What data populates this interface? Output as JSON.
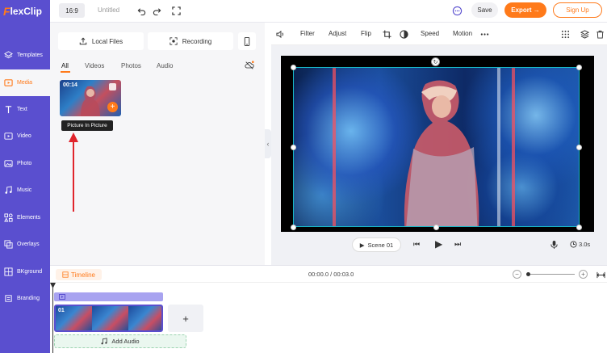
{
  "app": {
    "logo_mark": "F",
    "logo_text": "lexClip"
  },
  "sidebar": {
    "items": [
      {
        "label": "Templates",
        "icon": "templates-icon"
      },
      {
        "label": "Media",
        "icon": "media-icon",
        "active": true
      },
      {
        "label": "Text",
        "icon": "text-icon"
      },
      {
        "label": "Video",
        "icon": "video-icon"
      },
      {
        "label": "Photo",
        "icon": "photo-icon"
      },
      {
        "label": "Music",
        "icon": "music-icon"
      },
      {
        "label": "Elements",
        "icon": "elements-icon"
      },
      {
        "label": "Overlays",
        "icon": "overlays-icon"
      },
      {
        "label": "BKground",
        "icon": "background-icon"
      },
      {
        "label": "Branding",
        "icon": "branding-icon"
      }
    ]
  },
  "topbar": {
    "ratio": "16:9",
    "title": "Untitled",
    "save": "Save",
    "export": "Export →",
    "signup": "Sign Up"
  },
  "media": {
    "local_files": "Local Files",
    "recording": "Recording",
    "tabs": [
      "All",
      "Videos",
      "Photos",
      "Audio"
    ],
    "thumb_duration": "00:14",
    "tooltip": "Picture In Picture"
  },
  "editor_toolbar": {
    "filter": "Filter",
    "adjust": "Adjust",
    "flip": "Flip",
    "speed": "Speed",
    "motion": "Motion"
  },
  "player": {
    "scene": "Scene 01",
    "duration": "3.0s"
  },
  "timeline": {
    "label": "Timeline",
    "time": "00:00.0 / 00:03.0",
    "clip_label": "01",
    "add_audio": "Add Audio"
  },
  "colors": {
    "accent": "#ff7a1a",
    "sidebar": "#5a4fcf"
  }
}
